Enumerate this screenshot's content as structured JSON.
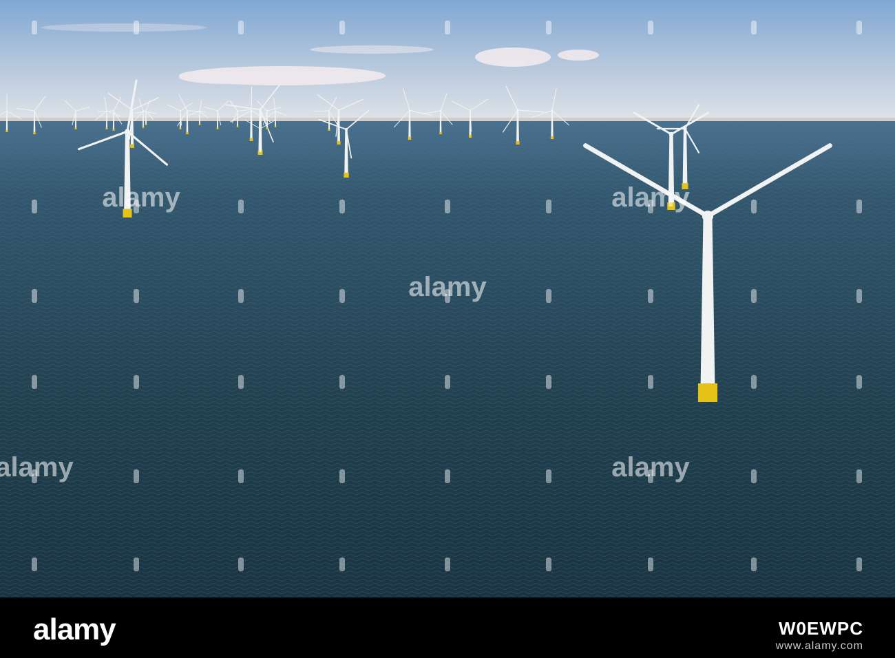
{
  "image": {
    "subject": "offshore-wind-farm",
    "colors": {
      "sky_top": "#8fb2d8",
      "sky_horizon": "#d6dde6",
      "sea_far": "#3e6583",
      "sea_near": "#1c3a4d",
      "tower": "#f1f3f2",
      "foundation": "#e5c21a"
    }
  },
  "watermark": {
    "text": "alamy"
  },
  "footer": {
    "brand": "alamy",
    "image_id": "W0EWPC",
    "url": "www.alamy.com"
  }
}
